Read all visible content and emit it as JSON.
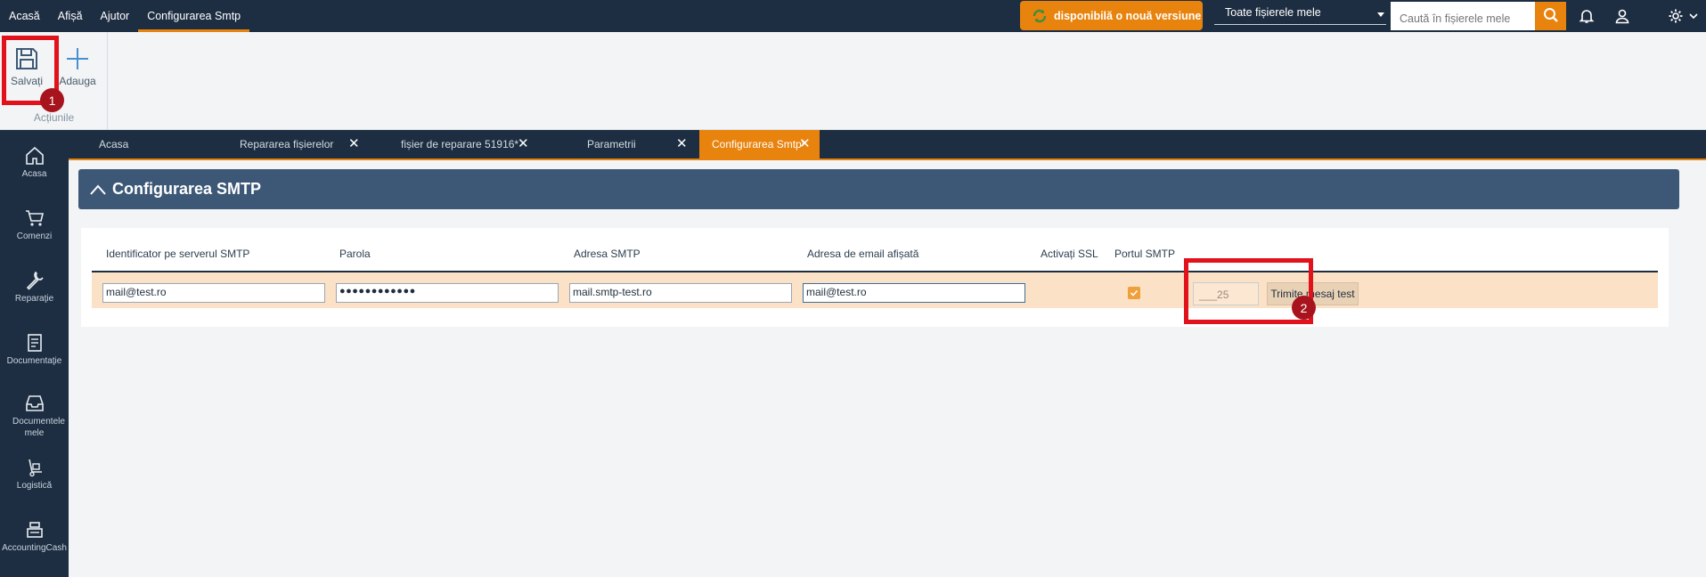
{
  "topnav": {
    "items": [
      "Acasă",
      "Afișă",
      "Ajutor",
      "Configurarea Smtp"
    ]
  },
  "update": {
    "label": "disponibilă o nouă versiune"
  },
  "search": {
    "scope_selected": "Toate fișierele mele",
    "placeholder": "Caută în fișierele mele"
  },
  "ribbon": {
    "save_label": "Salvați",
    "add_label": "Adauga",
    "group_label": "Acțiunile"
  },
  "sidebar": {
    "items": [
      "Acasa",
      "Comenzi",
      "Reparaţie",
      "Documentaţie",
      "Documentele mele",
      "Logistică",
      "AccountingCash"
    ]
  },
  "tabs": [
    {
      "label": "Acasa"
    },
    {
      "label": "Repararea fișierelor"
    },
    {
      "label": "fișier de reparare 51916*"
    },
    {
      "label": "Parametrii"
    },
    {
      "label": "Configurarea Smtp*"
    }
  ],
  "panel": {
    "title": "Configurarea SMTP"
  },
  "table": {
    "headers": [
      "Identificator pe serverul SMTP",
      "Parola",
      "Adresa SMTP",
      "Adresa de email afișată",
      "Activați SSL",
      "Portul SMTP"
    ],
    "row": {
      "identifier": "mail@test.ro",
      "password": "●●●●●●●●●●●●",
      "smtp_address": "mail.smtp-test.ro",
      "display_email": "mail@test.ro",
      "ssl_enabled": true,
      "port": "___25",
      "test_button": "Trimite mesaj test"
    }
  },
  "annotations": {
    "badge_1": "1",
    "badge_2": "2"
  },
  "colors": {
    "accent": "#e8830e",
    "navbar": "#1e2e42",
    "panel_header": "#3d5876",
    "highlight": "#e1121b",
    "badge": "#a8141d"
  }
}
